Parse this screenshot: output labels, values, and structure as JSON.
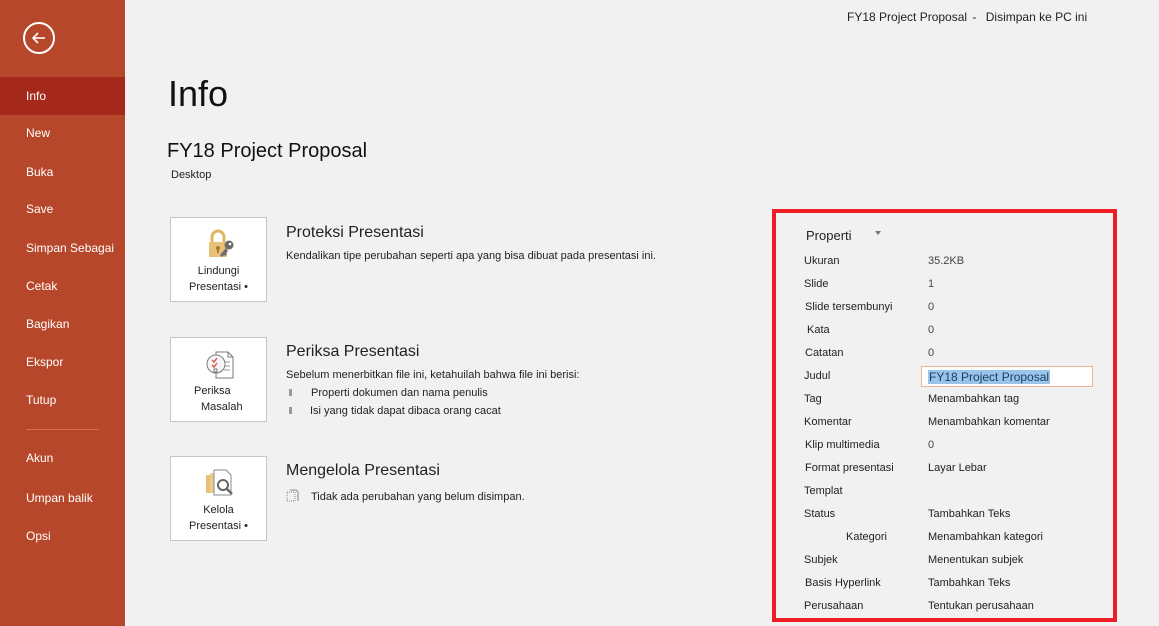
{
  "window": {
    "doc_name": "FY18 Project Proposal",
    "separator": "-",
    "save_status": "Disimpan ke PC ini"
  },
  "sidebar": {
    "back_label": "Back",
    "items": [
      {
        "label": "Info",
        "active": true
      },
      {
        "label": "New"
      },
      {
        "label": "Buka"
      },
      {
        "label": "Save"
      },
      {
        "label": "Simpan Sebagai"
      },
      {
        "label": "Cetak"
      },
      {
        "label": "Bagikan"
      },
      {
        "label": "Ekspor"
      },
      {
        "label": "Tutup"
      },
      {
        "label": "Akun"
      },
      {
        "label": "Umpan balik"
      },
      {
        "label": "Opsi"
      }
    ]
  },
  "colors": {
    "sidebar_bg": "#b7472a",
    "sidebar_active": "#a4291c",
    "highlight_border": "#ee1c25",
    "selection": "#99c4ea"
  },
  "main": {
    "page_title": "Info",
    "doc_title": "FY18 Project Proposal",
    "doc_location": "Desktop",
    "sections": [
      {
        "tile_label_1": "Lindungi",
        "tile_label_2": "Presentasi •",
        "icon": "lock-key-icon",
        "title": "Proteksi Presentasi",
        "description": "Kendalikan tipe perubahan seperti apa yang bisa dibuat pada presentasi ini."
      },
      {
        "tile_label_1": "Periksa",
        "tile_label_2": "Masalah",
        "icon": "inspect-document-icon",
        "title": "Periksa Presentasi",
        "description": "Sebelum menerbitkan file ini, ketahuilah bahwa file ini berisi:",
        "bullets": [
          "Properti dokumen dan nama penulis",
          "Isi yang tidak dapat dibaca orang cacat"
        ]
      },
      {
        "tile_label_1": "Kelola",
        "tile_label_2": "Presentasi •",
        "icon": "manage-versions-icon",
        "title": "Mengelola Presentasi",
        "description": "Tidak ada perubahan yang belum disimpan."
      }
    ]
  },
  "properties": {
    "header": "Properti",
    "rows": [
      {
        "label": "Ukuran",
        "value": "35.2KB"
      },
      {
        "label": "Slide",
        "value": "1"
      },
      {
        "label": "Slide tersembunyi",
        "value": "0"
      },
      {
        "label": "Kata",
        "value": "0"
      },
      {
        "label": "Catatan",
        "value": "0"
      },
      {
        "label": "Judul",
        "value": "FY18 Project Proposal"
      },
      {
        "label": "Tag",
        "value": "Menambahkan tag"
      },
      {
        "label": "Komentar",
        "value": "Menambahkan komentar"
      },
      {
        "label": "Klip multimedia",
        "value": "0"
      },
      {
        "label": "Format presentasi",
        "value": "Layar Lebar"
      },
      {
        "label": "Templat",
        "value": ""
      },
      {
        "label": "Status",
        "value": "Tambahkan Teks"
      },
      {
        "label": "Kategori",
        "value": "Menambahkan kategori"
      },
      {
        "label": "Subjek",
        "value": "Menentukan subjek"
      },
      {
        "label": "Basis Hyperlink",
        "value": "Tambahkan Teks"
      },
      {
        "label": "Perusahaan",
        "value": "Tentukan perusahaan"
      }
    ]
  }
}
